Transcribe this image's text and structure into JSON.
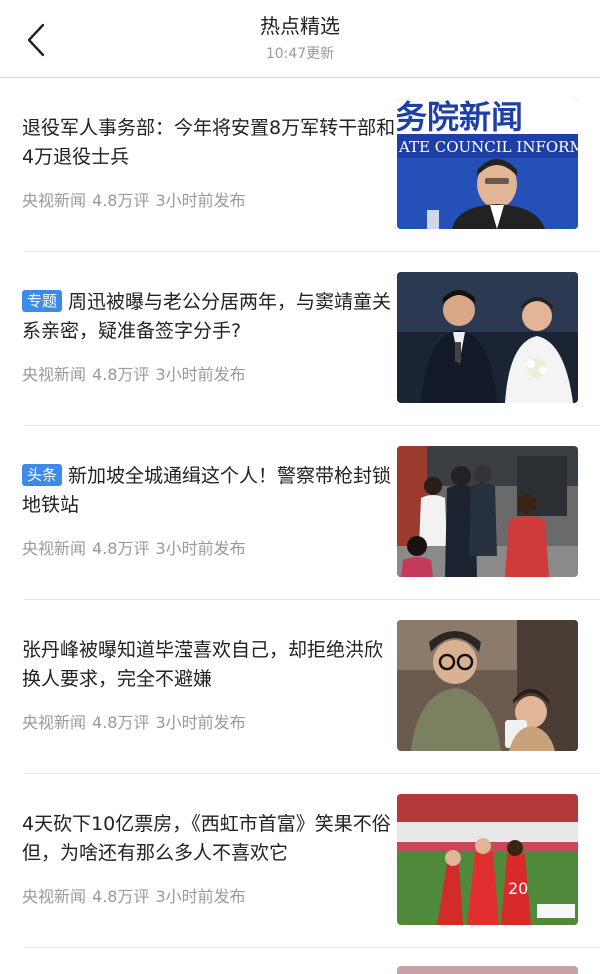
{
  "header": {
    "title": "热点精选",
    "subtitle": "10:47更新"
  },
  "items": [
    {
      "tag": "",
      "title": "退役军人事务部：今年将安置8万军转干部和4万退役士兵",
      "source": "央视新闻",
      "comments": "4.8万评",
      "time": "3小时前发布",
      "thumb_text_1": "务院新闻",
      "thumb_text_2": "ATE COUNCIL INFORM"
    },
    {
      "tag": "专题",
      "title": "周迅被曝与老公分居两年，与窦靖童关系亲密，疑准备签字分手?",
      "source": "央视新闻",
      "comments": "4.8万评",
      "time": "3小时前发布"
    },
    {
      "tag": "头条",
      "title": "新加坡全城通缉这个人！警察带枪封锁地铁站",
      "source": "央视新闻",
      "comments": "4.8万评",
      "time": "3小时前发布"
    },
    {
      "tag": "",
      "title": "张丹峰被曝知道毕滢喜欢自己，却拒绝洪欣换人要求，完全不避嫌",
      "source": "央视新闻",
      "comments": "4.8万评",
      "time": "3小时前发布"
    },
    {
      "tag": "",
      "title": "4天砍下10亿票房，《西虹市首富》笑果不俗 但，为啥还有那么多人不喜欢它",
      "source": "央视新闻",
      "comments": "4.8万评",
      "time": "3小时前发布",
      "thumb_text_1": "20"
    }
  ],
  "colors": {
    "tag_bg": "#3d8be8",
    "meta": "#9a9a9a"
  }
}
